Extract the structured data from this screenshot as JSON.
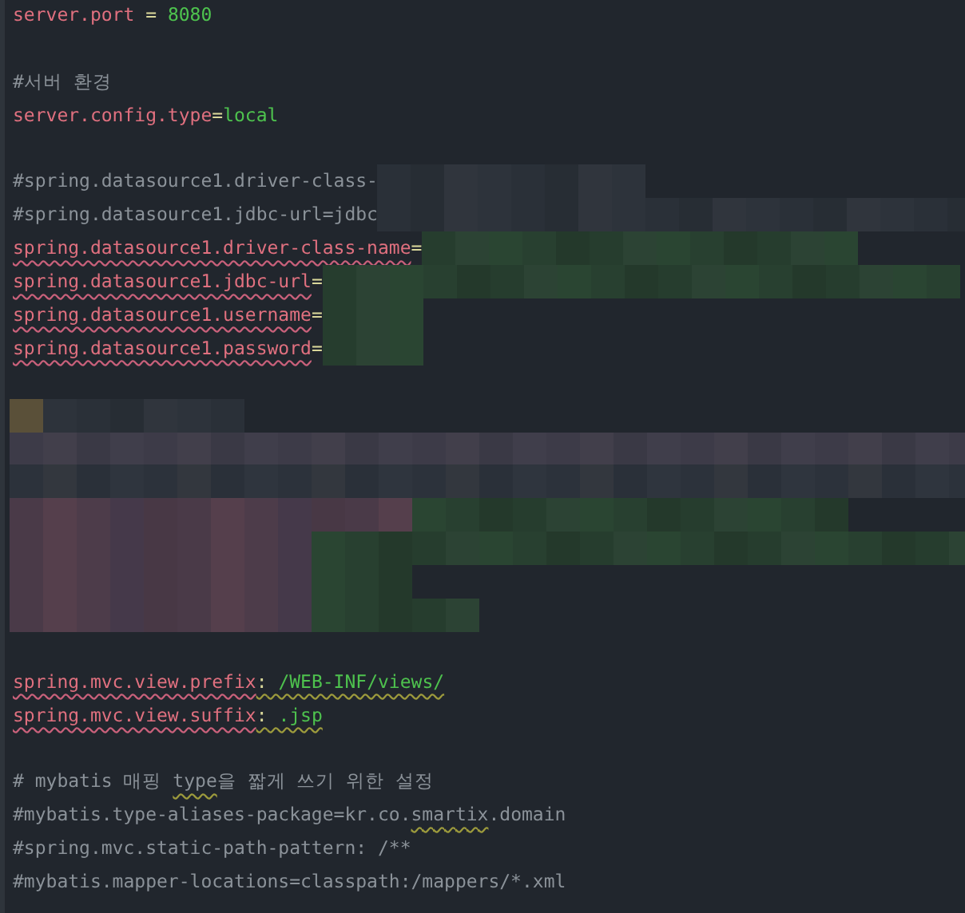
{
  "editor": {
    "lines": [
      {
        "kind": "code",
        "segments": [
          {
            "text": "server.port",
            "kind": "key",
            "warn": false
          },
          {
            "text": " = ",
            "kind": "op",
            "warn": false
          },
          {
            "text": "8080",
            "kind": "value",
            "warn": false
          }
        ]
      },
      {
        "kind": "blank"
      },
      {
        "kind": "code",
        "segments": [
          {
            "text": "#서버 환경",
            "kind": "comment",
            "warn": false
          }
        ]
      },
      {
        "kind": "code",
        "segments": [
          {
            "text": "server.config.type",
            "kind": "key",
            "warn": false
          },
          {
            "text": "=",
            "kind": "op",
            "warn": false
          },
          {
            "text": "local",
            "kind": "value",
            "warn": false
          }
        ]
      },
      {
        "kind": "blank"
      },
      {
        "kind": "code",
        "redacted_tail": true,
        "segments": [
          {
            "text": "#spring.datasource1.driver-class-",
            "kind": "comment",
            "warn": false
          }
        ]
      },
      {
        "kind": "code",
        "redacted_tail": true,
        "segments": [
          {
            "text": "#spring.datasource1.jdbc-url=jdbc",
            "kind": "comment",
            "warn": false
          }
        ]
      },
      {
        "kind": "code",
        "redacted_tail": true,
        "segments": [
          {
            "text": "spring.datasource1.driver-class-name",
            "kind": "key",
            "warn": true
          },
          {
            "text": "=",
            "kind": "op",
            "warn": false
          }
        ]
      },
      {
        "kind": "code",
        "redacted_tail": true,
        "segments": [
          {
            "text": "spring.datasource1.jdbc-url",
            "kind": "key",
            "warn": true
          },
          {
            "text": "=",
            "kind": "op",
            "warn": false
          }
        ]
      },
      {
        "kind": "code",
        "redacted_tail": true,
        "segments": [
          {
            "text": "spring.datasource1.username",
            "kind": "key",
            "warn": true
          },
          {
            "text": "=",
            "kind": "op",
            "warn": false
          }
        ]
      },
      {
        "kind": "code",
        "redacted_tail": true,
        "segments": [
          {
            "text": "spring.datasource1.password",
            "kind": "key",
            "warn": true
          },
          {
            "text": "=",
            "kind": "op",
            "warn": false
          }
        ]
      },
      {
        "kind": "blank"
      },
      {
        "kind": "redacted"
      },
      {
        "kind": "redacted"
      },
      {
        "kind": "redacted"
      },
      {
        "kind": "redacted"
      },
      {
        "kind": "redacted"
      },
      {
        "kind": "redacted"
      },
      {
        "kind": "redacted"
      },
      {
        "kind": "blank"
      },
      {
        "kind": "code",
        "segments": [
          {
            "text": "spring.mvc.view.prefix",
            "kind": "key",
            "warn": true
          },
          {
            "text": ":",
            "kind": "op",
            "warn": true
          },
          {
            "text": " /WEB-INF/views/",
            "kind": "value",
            "warn": true
          }
        ]
      },
      {
        "kind": "code",
        "segments": [
          {
            "text": "spring.mvc.view.suffix",
            "kind": "key",
            "warn": true
          },
          {
            "text": ":",
            "kind": "op",
            "warn": true
          },
          {
            "text": " .jsp",
            "kind": "value",
            "warn": true
          }
        ]
      },
      {
        "kind": "blank"
      },
      {
        "kind": "code",
        "segments": [
          {
            "text": "# mybatis 매핑 ",
            "kind": "comment",
            "warn": false
          },
          {
            "text": "type",
            "kind": "comment",
            "warn": true
          },
          {
            "text": "을 짧게 쓰기 위한 설정",
            "kind": "comment",
            "warn": false
          }
        ]
      },
      {
        "kind": "code",
        "segments": [
          {
            "text": "#mybatis.type-aliases-package=kr.co.",
            "kind": "comment",
            "warn": false
          },
          {
            "text": "smartix",
            "kind": "comment",
            "warn": true
          },
          {
            "text": ".domain",
            "kind": "comment",
            "warn": false
          }
        ]
      },
      {
        "kind": "code",
        "segments": [
          {
            "text": "#spring.mvc.static-path-pattern: /**",
            "kind": "comment",
            "warn": false
          }
        ]
      },
      {
        "kind": "code",
        "segments": [
          {
            "text": "#mybatis.mapper-locations=classpath:/mappers/*.xml",
            "kind": "comment",
            "warn": false
          }
        ]
      }
    ]
  }
}
